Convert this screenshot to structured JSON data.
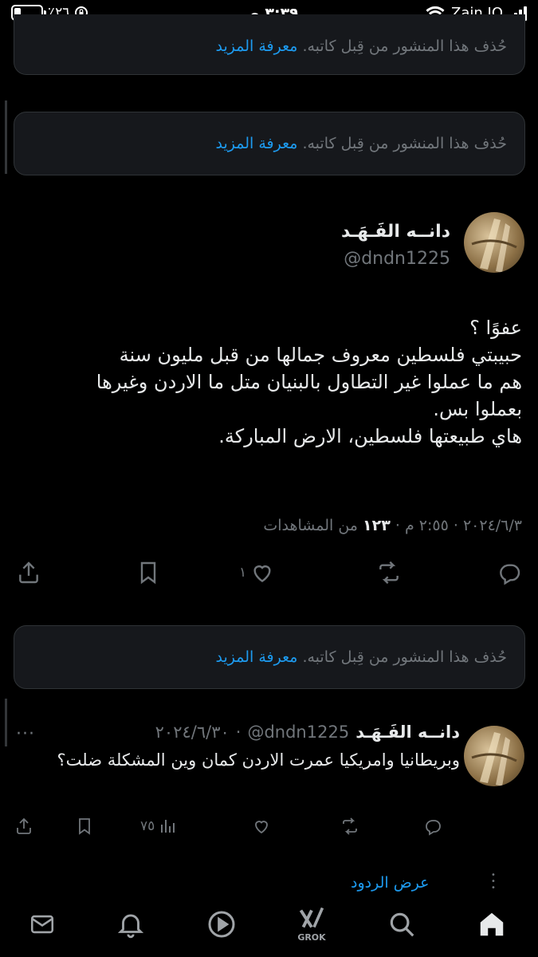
{
  "status_bar": {
    "battery": "٪٢٦",
    "time": "٣:٣٩ ص",
    "carrier": "Zain JO"
  },
  "deleted_notice": {
    "text": "حُذف هذا المنشور من قِبل كاتبه.",
    "learn_more": "معرفة المزيد"
  },
  "main_tweet": {
    "author_name": "دانــه الفَـهَـد",
    "handle": "@dndn1225",
    "body": "عفوًا ؟\nحبيبتي فلسطين معروف جمالها من قبل مليون سنة\nهم ما عملوا غير التطاول بالبنيان متل ما الاردن وغيرها\nبعملوا بس.\nهاي طبيعتها فلسطين، الارض المباركة.",
    "date": "٢٠٢٤/٦/٣",
    "time": "٢:٥٥ م",
    "views_count": "١٢٣",
    "views_label": "من المشاهدات",
    "sep": "·",
    "likes": "١"
  },
  "reply_tweet": {
    "author_name": "دانــه الفَـهَـد",
    "handle": "@dndn1225",
    "date": "٢٠٢٤/٦/٣٠",
    "sep": "·",
    "more": "···",
    "body": "وبريطانيا وامريكيا عمرت الاردن كمان وين المشكلة ضلت؟",
    "views": "٧٥"
  },
  "show_replies": "عرض الردود",
  "nav": {
    "grok_label": "GROK"
  },
  "colors": {
    "background": "#000000",
    "card_bg": "#16181c",
    "accent": "#1d9bf0",
    "muted": "#71767b"
  }
}
